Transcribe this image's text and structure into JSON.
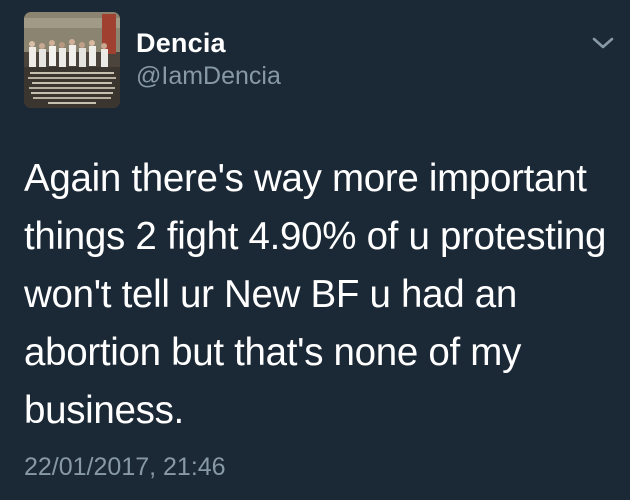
{
  "tweet": {
    "author": {
      "name": "Dencia",
      "handle": "@IamDencia"
    },
    "text_lines": [
      "Again there's way more important",
      "things 2 fight 4.90% of u protesting",
      "won't tell ur New BF u had an",
      "abortion but that's none of my",
      "business."
    ],
    "timestamp": "22/01/2017, 21:46",
    "menu_icon": "chevron-down-icon"
  },
  "colors": {
    "background": "#1b2836",
    "primary_text": "#ffffff",
    "secondary_text": "#8899a6"
  }
}
